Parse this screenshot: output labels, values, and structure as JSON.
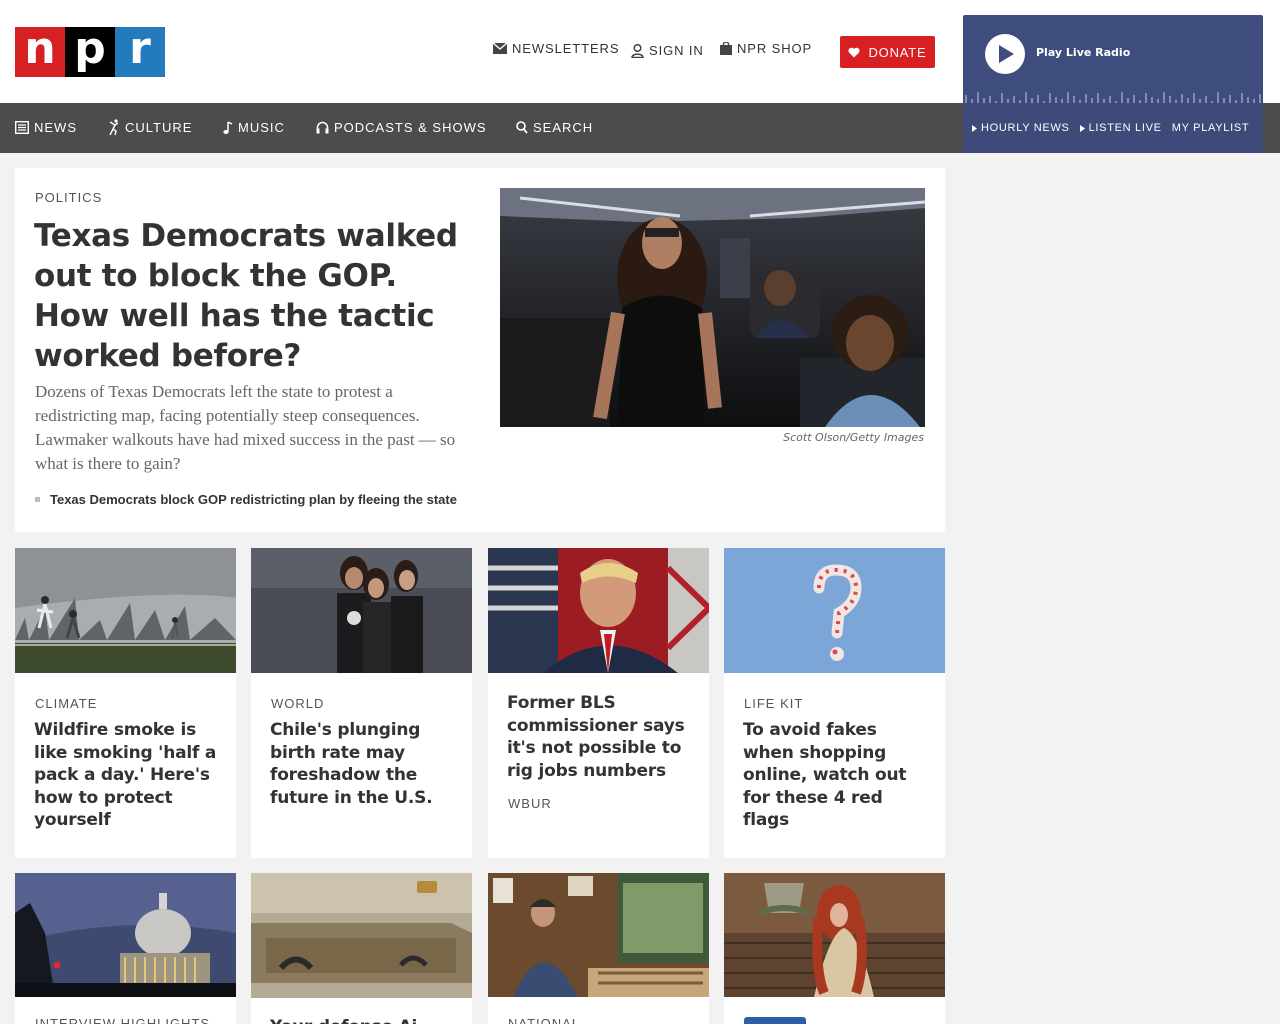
{
  "header": {
    "logo": [
      "n",
      "p",
      "r"
    ],
    "links": [
      {
        "icon": "envelope-icon",
        "label": "NEWSLETTERS"
      },
      {
        "icon": "user-icon",
        "label": "SIGN IN"
      },
      {
        "icon": "bag-icon",
        "label": "NPR SHOP"
      }
    ],
    "donate": {
      "icon": "heart-icon",
      "label": "DONATE"
    }
  },
  "player": {
    "play_label": "Play Live Radio",
    "links": [
      "HOURLY NEWS",
      "LISTEN LIVE",
      "MY PLAYLIST"
    ]
  },
  "nav": [
    {
      "icon": "newspaper-icon",
      "label": "NEWS"
    },
    {
      "icon": "dancer-icon",
      "label": "CULTURE"
    },
    {
      "icon": "music-note-icon",
      "label": "MUSIC"
    },
    {
      "icon": "headphones-icon",
      "label": "PODCASTS & SHOWS"
    },
    {
      "icon": "search-icon",
      "label": "SEARCH"
    }
  ],
  "lead": {
    "slug": "POLITICS",
    "headline": "Texas Democrats walked out to block the GOP. How well has the tactic worked before?",
    "teaser": "Dozens of Texas Democrats left the state to protest a redistricting map, facing potentially steep consequences. Lawmaker walkouts have had mixed success in the past — so what is there to gain?",
    "credit": "Scott Olson/Getty Images",
    "related": "Texas Democrats block GOP redistricting plan by fleeing the state"
  },
  "cards": [
    {
      "slug": "CLIMATE",
      "headline": "Wildfire smoke is like smoking 'half a pack a day.' Here's how to protect yourself",
      "source": ""
    },
    {
      "slug": "WORLD",
      "headline": "Chile's plunging birth rate may foreshadow the future in the U.S.",
      "source": ""
    },
    {
      "slug": "",
      "headline": "Former BLS commissioner says it's not possible to rig jobs numbers",
      "source": "WBUR"
    },
    {
      "slug": "LIFE KIT",
      "headline": "To avoid fakes when shopping online, watch out for these 4 red flags",
      "source": ""
    }
  ],
  "cards_row2": [
    {
      "slug": "INTERVIEW HIGHLIGHTS"
    },
    {
      "headline": "Your defense Ai"
    },
    {
      "slug": "NATIONAL"
    },
    {
      "slug": ""
    }
  ]
}
